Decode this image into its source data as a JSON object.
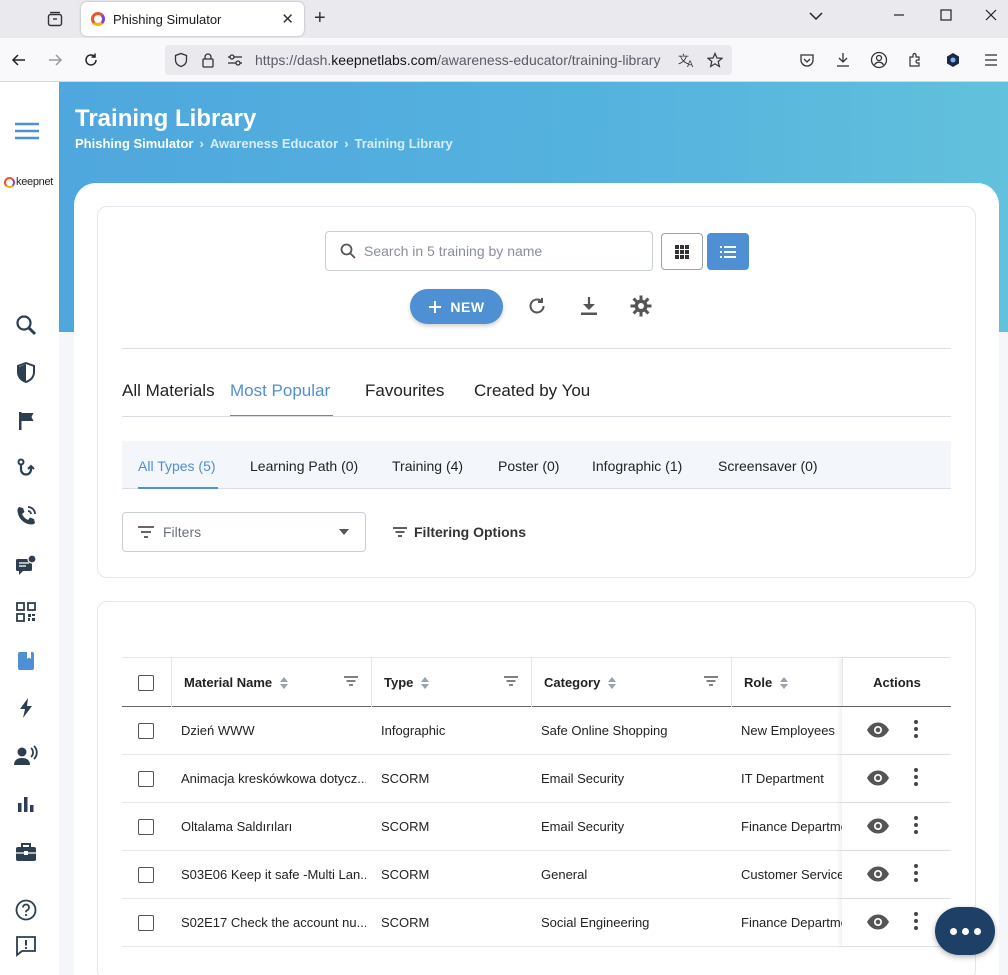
{
  "browser": {
    "tab_title": "Phishing Simulator",
    "url_prefix": "https://dash.",
    "url_domain": "keepnetlabs.com",
    "url_path": "/awareness-educator/training-library"
  },
  "sidebar": {
    "logo_text": "keepnet",
    "items": [
      "search-report-icon",
      "shield-icon",
      "flag-icon",
      "hook-icon",
      "phone-icon",
      "sms-icon",
      "qr-code-icon",
      "book-icon",
      "lightning-icon",
      "voice-user-icon",
      "bar-chart-icon",
      "briefcase-icon",
      "help-icon",
      "feedback-icon"
    ]
  },
  "header": {
    "title": "Training Library",
    "breadcrumb": [
      "Phishing Simulator",
      "Awareness Educator",
      "Training Library"
    ]
  },
  "toolbar": {
    "search_placeholder": "Search in 5 training by name",
    "new_label": "NEW"
  },
  "main_tabs": [
    {
      "label": "All Materials",
      "active": false
    },
    {
      "label": "Most Popular",
      "active": true
    },
    {
      "label": "Favourites",
      "active": false
    },
    {
      "label": "Created by You",
      "active": false
    }
  ],
  "type_tabs": [
    {
      "label": "All Types (5)",
      "active": true
    },
    {
      "label": "Learning Path (0)",
      "active": false
    },
    {
      "label": "Training (4)",
      "active": false
    },
    {
      "label": "Poster (0)",
      "active": false
    },
    {
      "label": "Infographic (1)",
      "active": false
    },
    {
      "label": "Screensaver (0)",
      "active": false
    }
  ],
  "filters": {
    "placeholder": "Filters",
    "options_label": "Filtering Options"
  },
  "table": {
    "columns": [
      "Material Name",
      "Type",
      "Category",
      "Role",
      "Actions"
    ],
    "rows": [
      {
        "name": "Dzień WWW",
        "type": "Infographic",
        "category": "Safe Online Shopping",
        "role": "New Employees"
      },
      {
        "name": "Animacja kreskówkowa dotycz...",
        "type": "SCORM",
        "category": "Email Security",
        "role": "IT Department"
      },
      {
        "name": "Oltalama Saldırıları",
        "type": "SCORM",
        "category": "Email Security",
        "role": "Finance Departme"
      },
      {
        "name": "S03E06 Keep it safe -Multi Lan...",
        "type": "SCORM",
        "category": "General",
        "role": "Customer Service"
      },
      {
        "name": "S02E17 Check the account nu...",
        "type": "SCORM",
        "category": "Social Engineering",
        "role": "Finance Departme"
      }
    ]
  },
  "colors": {
    "accent": "#4f8fd3",
    "banner": "#55b3de",
    "fab": "#1e3f66"
  }
}
